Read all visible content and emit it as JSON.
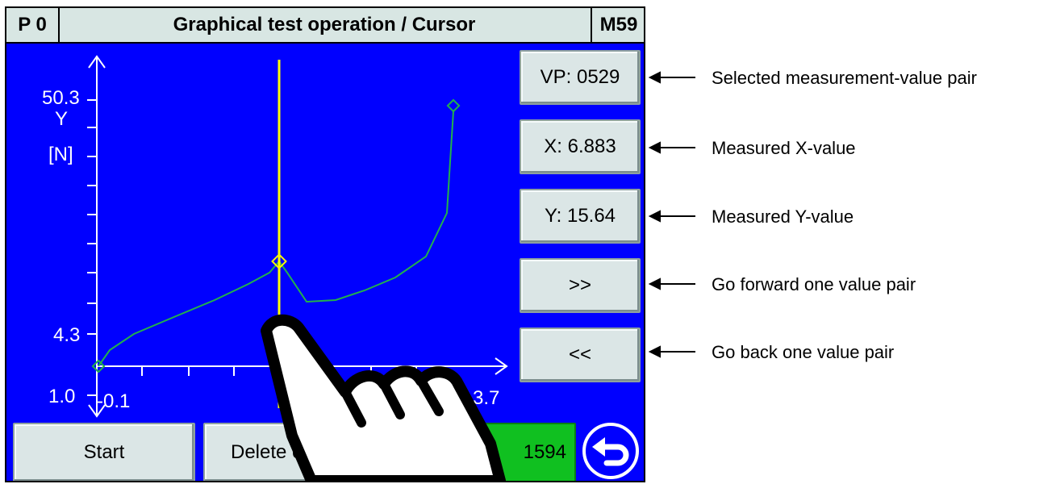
{
  "header": {
    "program": "P 0",
    "title": "Graphical test operation / Cursor",
    "mode": "M59"
  },
  "chart_data": {
    "type": "line",
    "ylabel_line1": "Y",
    "ylabel_line2": "[N]",
    "y_ticks_labeled": [
      "50.3",
      "4.3",
      "1.0"
    ],
    "x_ticks_labeled": [
      "-0.1",
      "3.7"
    ],
    "cursor": {
      "vp": "0529",
      "x": "6.883",
      "y": "15.64"
    },
    "series": [
      {
        "color": "#22b14c"
      }
    ],
    "cursor_color": "#ffff00"
  },
  "side_buttons": {
    "vp": "VP: 0529",
    "x": "X: 6.883",
    "y": "Y: 15.64",
    "forward": ">>",
    "back": "<<"
  },
  "bottom_buttons": {
    "start": "Start",
    "delete": "Delete cu",
    "counter": "1594"
  },
  "annotations": {
    "vp": "Selected measurement-value pair",
    "x": "Measured X-value",
    "y": "Measured Y-value",
    "forward": "Go forward one value pair",
    "back": "Go back one value pair"
  }
}
